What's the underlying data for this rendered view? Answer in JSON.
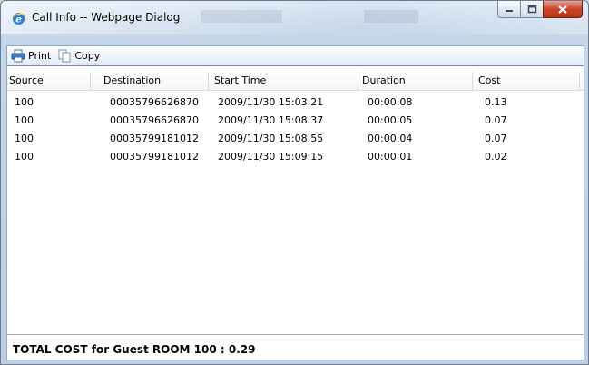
{
  "window": {
    "title": "Call Info -- Webpage Dialog"
  },
  "toolbar": {
    "print_label": "Print",
    "copy_label": "Copy"
  },
  "table": {
    "columns": [
      "Source",
      "Destination",
      "Start Time",
      "Duration",
      "Cost"
    ],
    "rows": [
      [
        "100",
        "00035796626870",
        "2009/11/30 15:03:21",
        "00:00:08",
        "0.13"
      ],
      [
        "100",
        "00035796626870",
        "2009/11/30 15:08:37",
        "00:00:05",
        "0.07"
      ],
      [
        "100",
        "00035799181012",
        "2009/11/30 15:08:55",
        "00:00:04",
        "0.07"
      ],
      [
        "100",
        "00035799181012",
        "2009/11/30 15:09:15",
        "00:00:01",
        "0.02"
      ]
    ]
  },
  "footer": {
    "total_text": "TOTAL COST for Guest ROOM 100 : 0.29"
  },
  "icons": {
    "app": "internet-explorer-icon",
    "print": "printer-icon",
    "copy": "copy-icon"
  }
}
